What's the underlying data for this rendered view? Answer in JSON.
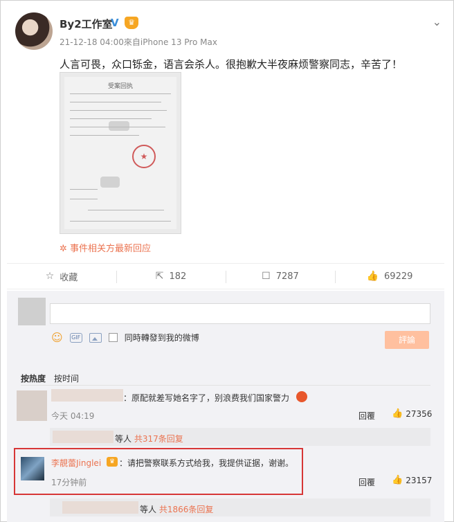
{
  "post": {
    "author": "By2工作室",
    "verify_mark": "V",
    "meta": "21-12-18 04:00來自iPhone 13 Pro Max",
    "text": "人言可畏，众口铄金，语言会杀人。很抱歉大半夜麻烦警察同志，辛苦了！",
    "doc_title": "受案回执",
    "related_link": "事件相关方最新回应",
    "related_icon": "asterisk-icon"
  },
  "actions": {
    "favorite_label": "收藏",
    "repost_count": "182",
    "comment_count": "7287",
    "like_count": "69229"
  },
  "composer": {
    "also_post_label": "同時轉發到我的微博",
    "submit_label": "評論"
  },
  "sort": {
    "hot": "按热度",
    "time": "按时间"
  },
  "comments": [
    {
      "text": "：原配就差写她名字了，别浪费我们国家警力",
      "time": "今天 04:19",
      "reply_label": "回覆",
      "likes": "27356",
      "sub_suffix": "等人",
      "sub_count": "共317条回复"
    },
    {
      "name": "李靚蕾Jinglei",
      "text": "：请把警察联系方式给我，我提供证据，谢谢。",
      "time": "17分钟前",
      "reply_label": "回覆",
      "likes": "23157",
      "sub_suffix": "等人",
      "sub_count": "共1866条回复"
    }
  ]
}
